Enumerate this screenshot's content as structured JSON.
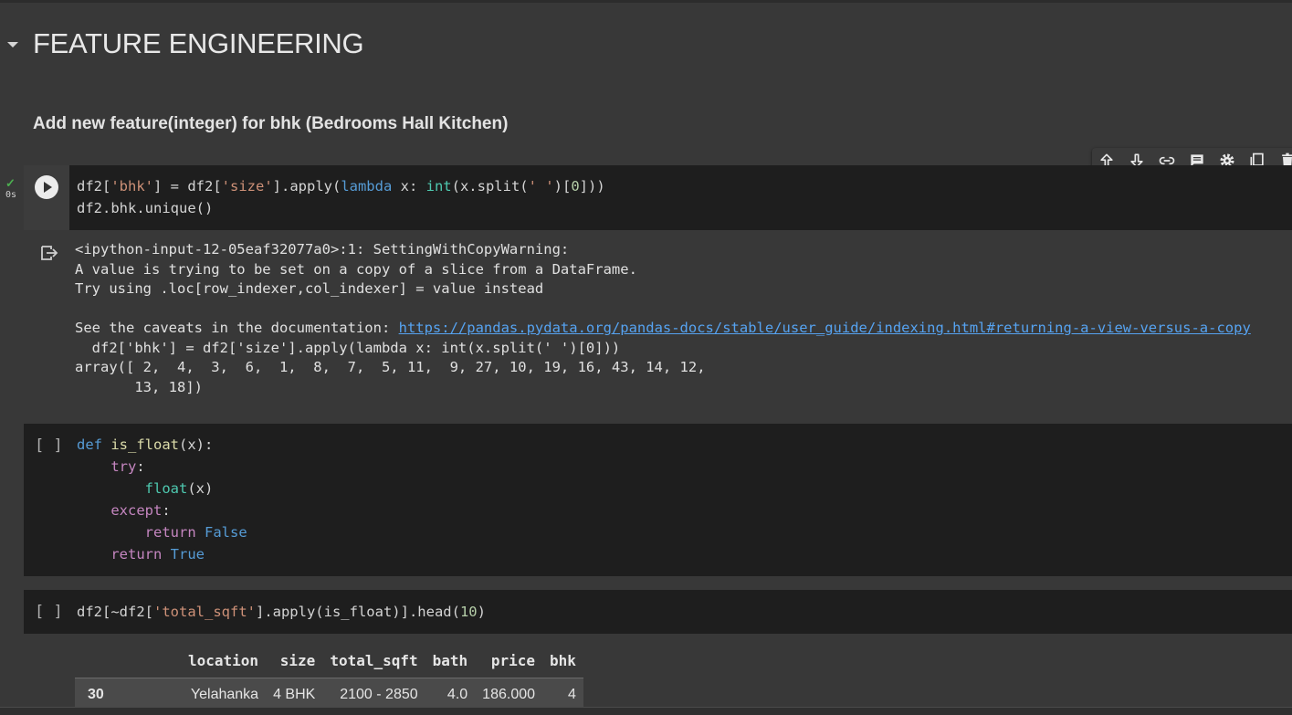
{
  "section": {
    "title": "FEATURE ENGINEERING"
  },
  "subtitle": "Add new feature(integer) for bhk (Bedrooms Hall Kitchen)",
  "cell1": {
    "status_time": "0s",
    "line1": {
      "a": "df2[",
      "b": "'bhk'",
      "c": "] = df2[",
      "d": "'size'",
      "e": "].apply(",
      "f": "lambda",
      "g": " x: ",
      "h": "int",
      "i": "(x.split(",
      "j": "' '",
      "k": ")[",
      "l": "0",
      "m": "]))"
    },
    "line2": "df2.bhk.unique()"
  },
  "output1": {
    "line1": "<ipython-input-12-05eaf32077a0>:1: SettingWithCopyWarning:",
    "line2": "A value is trying to be set on a copy of a slice from a DataFrame.",
    "line3": "Try using .loc[row_indexer,col_indexer] = value instead",
    "line4_prefix": "See the caveats in the documentation: ",
    "link": "https://pandas.pydata.org/pandas-docs/stable/user_guide/indexing.html#returning-a-view-versus-a-copy",
    "line5": "  df2['bhk'] = df2['size'].apply(lambda x: int(x.split(' ')[0]))",
    "line6": "array([ 2,  4,  3,  6,  1,  8,  7,  5, 11,  9, 27, 10, 19, 16, 43, 14, 12,",
    "line7": "       13, 18])"
  },
  "cell2": {
    "bracket": "[ ]",
    "def_kw": "def",
    "fn_name": "is_float",
    "params": "(x):",
    "try_kw": "try",
    "colon": ":",
    "float_fn": "float",
    "float_arg": "(x)",
    "except_kw": "except",
    "return_kw": "return",
    "false_val": "False",
    "true_val": "True"
  },
  "cell3": {
    "bracket": "[ ]",
    "a": "df2[~df2[",
    "b": "'total_sqft'",
    "c": "].apply(is_float)].head(",
    "d": "10",
    "e": ")"
  },
  "table": {
    "columns": [
      "location",
      "size",
      "total_sqft",
      "bath",
      "price",
      "bhk"
    ],
    "rows": [
      {
        "index": "30",
        "cells": [
          "Yelahanka",
          "4 BHK",
          "2100 - 2850",
          "4.0",
          "186.000",
          "4"
        ]
      }
    ]
  },
  "toolbar": {
    "icons": [
      "arrow-up-icon",
      "arrow-down-icon",
      "link-icon",
      "comment-icon",
      "settings-icon",
      "mirror-cell-icon",
      "delete-icon"
    ]
  }
}
